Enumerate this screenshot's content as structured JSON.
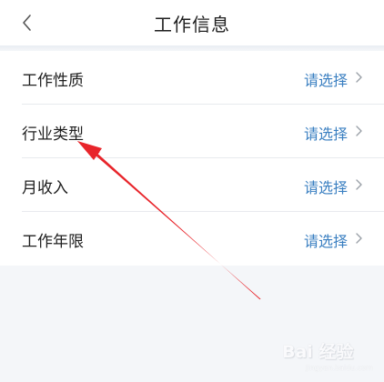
{
  "header": {
    "title": "工作信息",
    "back_icon": "chevron-left-icon"
  },
  "list": {
    "items": [
      {
        "label": "工作性质",
        "value": "请选择"
      },
      {
        "label": "行业类型",
        "value": "请选择"
      },
      {
        "label": "月收入",
        "value": "请选择"
      },
      {
        "label": "工作年限",
        "value": "请选择"
      }
    ]
  },
  "colors": {
    "accent_text": "#3a7fc1",
    "annotation_arrow": "#e8252b",
    "background": "#f4f6f9"
  },
  "watermark": {
    "brand": "Bai 经验",
    "url": "jingyan.baidu.com"
  }
}
